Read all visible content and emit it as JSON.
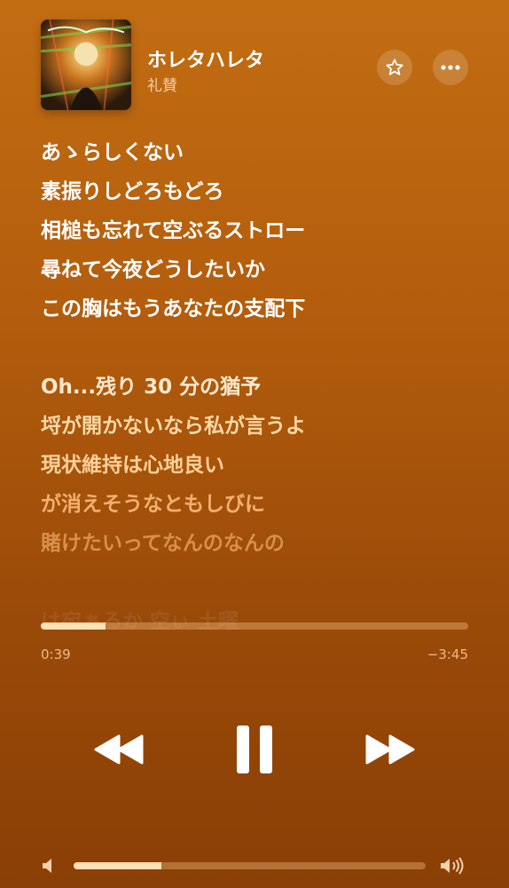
{
  "now_playing": {
    "title": "ホレタハレタ",
    "artist": "礼賛"
  },
  "buttons": {
    "favorite_icon": "star-icon",
    "more_icon": "ellipsis-icon"
  },
  "lyrics": {
    "lines": [
      "あゝらしくない",
      "素振りしどろもどろ",
      "相槌も忘れて空ぶるストロー",
      "尋ねて今夜どうしたいか",
      "この胸はもうあなたの支配下",
      "",
      "Oh...残り 30 分の猶予",
      "埒が開かないなら私が言うよ",
      "現状維持は心地良い",
      "が消えそうなともしびに",
      "賭けたいってなんのなんの"
    ],
    "line_colors": [
      "#ffffff",
      "#ffffff",
      "#ffffff",
      "#ffffff",
      "#ffffff",
      "",
      "#ffe9cf",
      "#ffd9a8",
      "#ffd09a",
      "#f2b070",
      "#d9904a"
    ],
    "faded_line": "は宛ぁるか 空ぃ 土曜"
  },
  "playback": {
    "elapsed": "0:39",
    "remaining": "−3:45",
    "progress_fraction": 0.152
  },
  "controls": {
    "rewind_icon": "backward-icon",
    "pause_icon": "pause-icon",
    "forward_icon": "forward-icon"
  },
  "volume": {
    "level_fraction": 0.25,
    "low_icon": "volume-low-icon",
    "high_icon": "volume-high-icon"
  }
}
